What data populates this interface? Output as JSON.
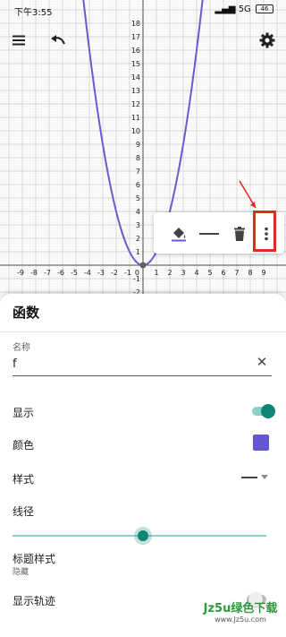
{
  "status_bar": {
    "time": "下午3:55",
    "signal_text": "5G",
    "battery": "46"
  },
  "toolbar": {
    "menu_icon": "menu-icon",
    "undo_icon": "undo-icon",
    "settings_icon": "gear-icon"
  },
  "graph": {
    "function": "x^2",
    "x_range": [
      -10,
      10
    ],
    "y_range": [
      -2,
      18
    ],
    "x_ticks": [
      "-9",
      "-8",
      "-7",
      "-6",
      "-5",
      "-4",
      "-3",
      "-2",
      "-1",
      "1",
      "2",
      "3",
      "4",
      "5",
      "6",
      "7",
      "8",
      "9"
    ],
    "y_ticks": [
      "-2",
      "-1",
      "1",
      "2",
      "3",
      "4",
      "5",
      "6",
      "7",
      "8",
      "9",
      "10",
      "11",
      "12",
      "13",
      "14",
      "15",
      "16",
      "17",
      "18"
    ],
    "origin_label": "0",
    "curve_color": "#6a5acd"
  },
  "style_toolbar": {
    "color_fill_icon": "paint-bucket-icon",
    "line_style_icon": "line-style-icon",
    "delete_icon": "trash-icon",
    "more_icon": "more-vertical-icon",
    "highlight_color": "#e02a1c"
  },
  "sheet": {
    "title": "函数",
    "name_label": "名称",
    "name_value": "f",
    "show_label": "显示",
    "show_enabled": true,
    "color_label": "颜色",
    "color_value": "#6557d2",
    "style_label": "样式",
    "thickness_label": "线径",
    "thickness_fraction": 0.515,
    "caption_style_label": "标题样式",
    "caption_style_value": "隐藏",
    "trace_label": "显示轨迹",
    "trace_enabled": false,
    "accent_color": "#0f8575"
  },
  "watermark": {
    "main": "Jz5u绿色下载",
    "sub": "www.Jz5u.com"
  }
}
